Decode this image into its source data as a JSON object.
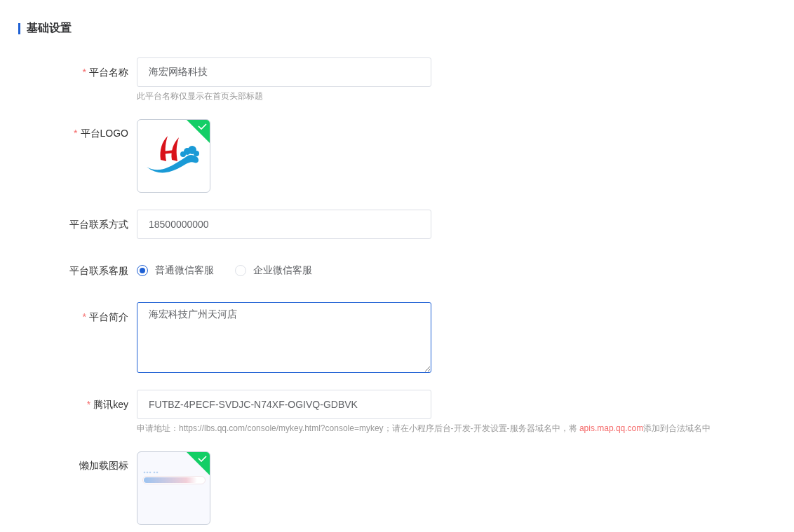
{
  "section_title": "基础设置",
  "fields": [
    {
      "kind": "text",
      "required_mark": "*",
      "label": "平台名称",
      "value": "海宏网络科技",
      "hint": {
        "before": "此平台名称仅显示在首页头部标题"
      }
    },
    {
      "kind": "upload",
      "required_mark": "*",
      "label": "平台LOGO",
      "uploaded": true
    },
    {
      "kind": "text",
      "label": "平台联系方式",
      "value": "18500000000"
    },
    {
      "kind": "radio",
      "label": "平台联系客服",
      "options": [
        {
          "label": "普通微信客服",
          "selected": true
        },
        {
          "label": "企业微信客服",
          "selected": false
        }
      ]
    },
    {
      "kind": "textarea",
      "required_mark": "*",
      "label": "平台简介",
      "value": "海宏科技广州天河店",
      "focused": true
    },
    {
      "kind": "text",
      "required_mark": "*",
      "label": "腾讯key",
      "value": "FUTBZ-4PECF-SVDJC-N74XF-OGIVQ-GDBVK",
      "hint": {
        "before": "申请地址：https://lbs.qq.com/console/mykey.html?console=mykey；请在小程序后台-开发-开发设置-服务器域名中，将 ",
        "highlight": "apis.map.qq.com",
        "after": "添加到合法域名中"
      }
    },
    {
      "kind": "upload",
      "label": "懒加载图标",
      "uploaded": true
    }
  ]
}
